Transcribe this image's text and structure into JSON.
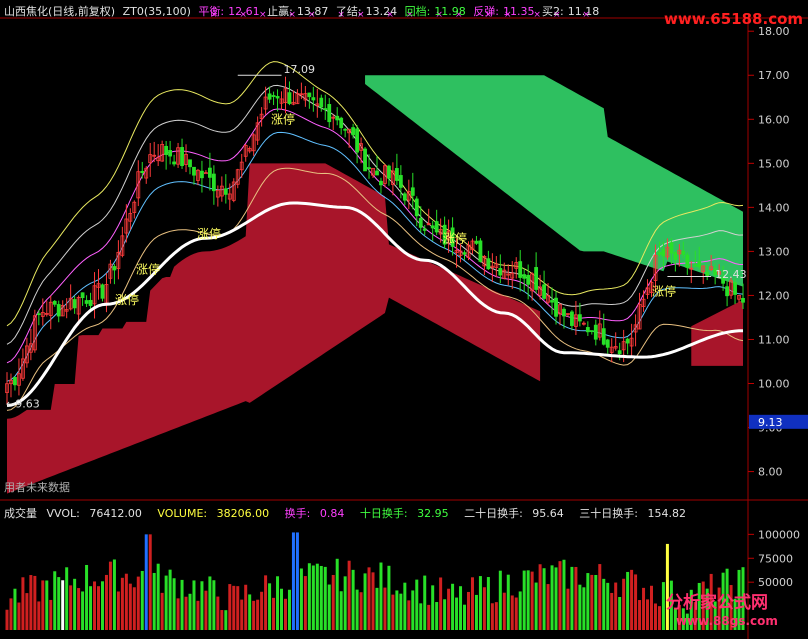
{
  "header": {
    "title": "山西焦化(日线,前复权)",
    "indicator": "ZT0(35,100)",
    "balance_label": "平衡:",
    "balance_value": "12.61",
    "stop_gain_label": "止赢:",
    "stop_gain_value": "13.87",
    "close_out_label": "了结:",
    "close_out_value": "13.24",
    "pullback_label": "回档:",
    "pullback_value": "11.98",
    "rebound_label": "反弹:",
    "rebound_value": "11.35",
    "buy2_label": "买2:",
    "buy2_value": "11.18"
  },
  "volume_header": {
    "title": "成交量",
    "vol_label": "VVOL:",
    "vol_value": "76412.00",
    "volume_label": "VOLUME:",
    "volume_value": "38206.00",
    "turnover_label": "换手:",
    "turnover_value": "0.84",
    "t10_label": "十日换手:",
    "t10_value": "32.95",
    "t20_label": "二十日换手:",
    "t20_value": "95.64",
    "t30_label": "三十日换手:",
    "t30_value": "154.82"
  },
  "price_axis": {
    "ticks": [
      "18.00",
      "17.00",
      "16.00",
      "15.00",
      "14.00",
      "13.00",
      "12.00",
      "11.00",
      "10.00",
      "9.00",
      "8.00"
    ],
    "current_marker": "9.13"
  },
  "volume_axis": {
    "ticks": [
      "100000",
      "75000",
      "50000"
    ]
  },
  "annotations": {
    "high_value": "17.09",
    "low_value": "9.63",
    "right_value": "12.43",
    "limit_up": "涨停",
    "footer_note": "用者未来数据"
  },
  "watermarks": {
    "top_right": "www.65188.com",
    "bottom_right": "分析家公式网",
    "bottom_url": "www.88gs.com"
  },
  "colors": {
    "up": "#ff3b3b",
    "down": "#28e028",
    "cloud_red": "#a8152a",
    "cloud_green": "#2ec060",
    "ma_white": "#ffffff",
    "header_magenta": "#ff40ff",
    "header_yellow": "#ffff40",
    "header_cyan": "#40ffff"
  },
  "chart_data": {
    "type": "candlestick",
    "title": "山西焦化(日线,前复权)",
    "y_range": [
      7.4,
      18.3
    ],
    "volume_range": [
      0,
      115000
    ],
    "price_path_keypoints": [
      {
        "bar": 0,
        "price": 10.0
      },
      {
        "bar": 10,
        "price": 11.7
      },
      {
        "bar": 22,
        "price": 12.0
      },
      {
        "bar": 38,
        "price": 15.3
      },
      {
        "bar": 55,
        "price": 14.5
      },
      {
        "bar": 68,
        "price": 16.6
      },
      {
        "bar": 80,
        "price": 16.2
      },
      {
        "bar": 95,
        "price": 14.7
      },
      {
        "bar": 110,
        "price": 13.3
      },
      {
        "bar": 128,
        "price": 12.6
      },
      {
        "bar": 145,
        "price": 11.3
      },
      {
        "bar": 155,
        "price": 10.9
      },
      {
        "bar": 165,
        "price": 12.9
      },
      {
        "bar": 178,
        "price": 12.4
      },
      {
        "bar": 185,
        "price": 11.9
      }
    ],
    "ma_long_keypoints": [
      {
        "bar": 0,
        "price": 9.5
      },
      {
        "bar": 25,
        "price": 11.8
      },
      {
        "bar": 50,
        "price": 13.3
      },
      {
        "bar": 72,
        "price": 14.1
      },
      {
        "bar": 85,
        "price": 14.0
      },
      {
        "bar": 105,
        "price": 12.8
      },
      {
        "bar": 125,
        "price": 11.6
      },
      {
        "bar": 140,
        "price": 10.7
      },
      {
        "bar": 160,
        "price": 10.6
      },
      {
        "bar": 185,
        "price": 11.2
      }
    ],
    "bar_count": 186
  }
}
